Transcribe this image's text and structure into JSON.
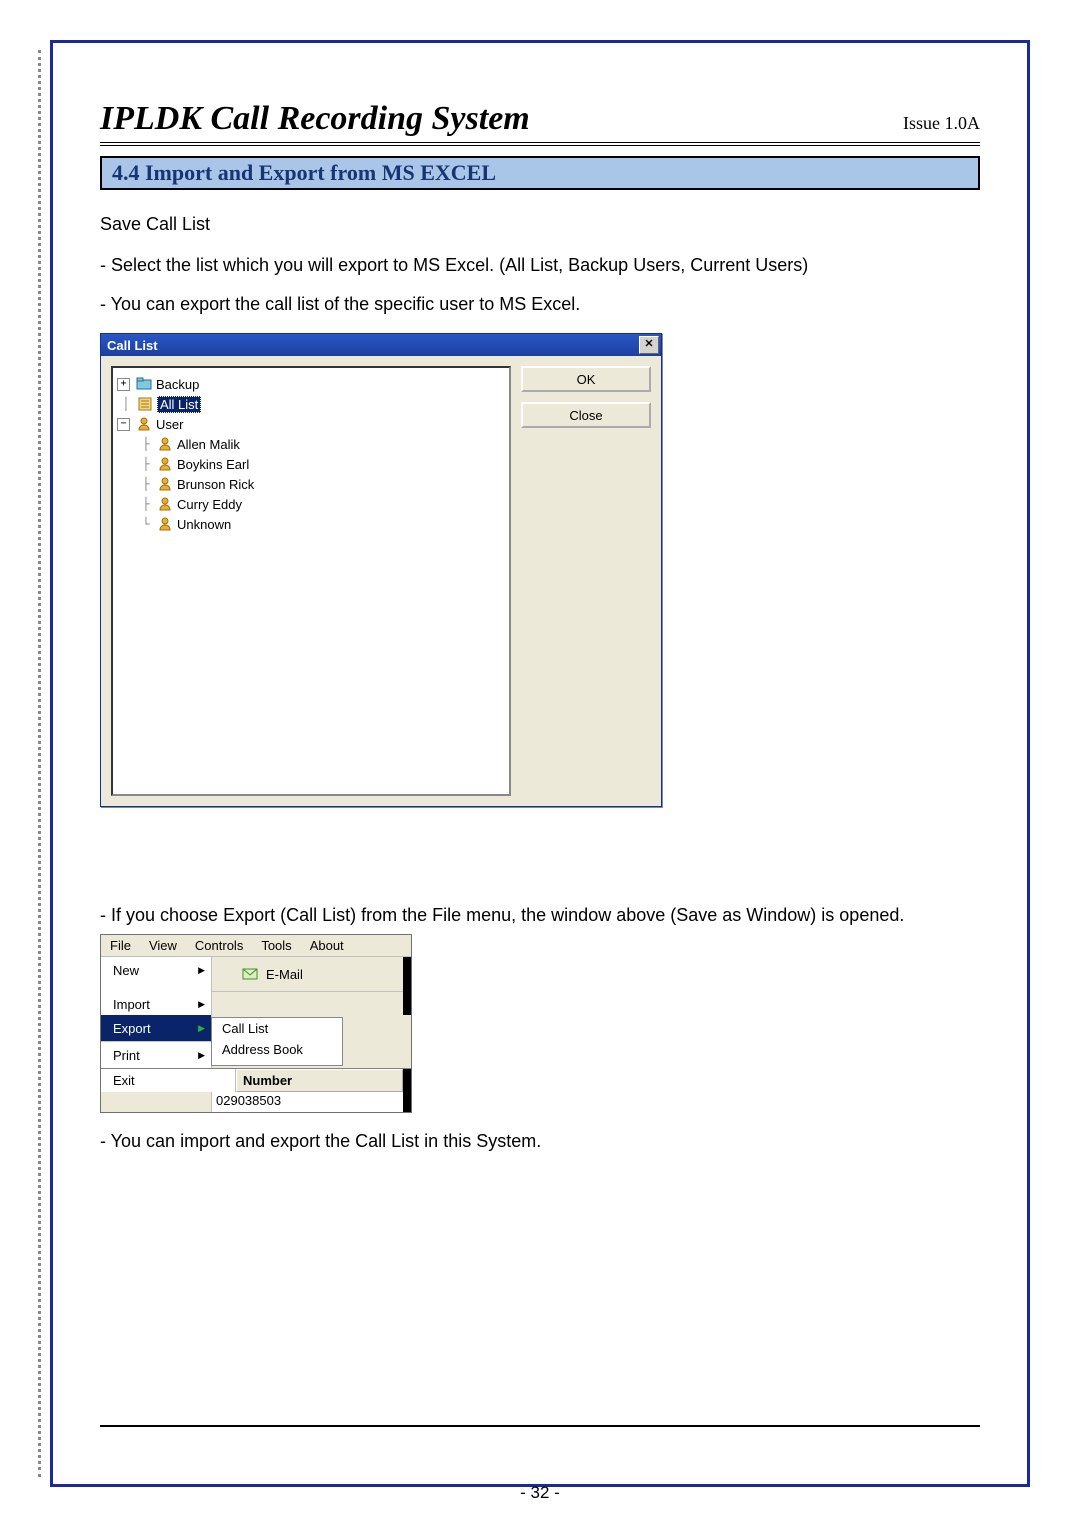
{
  "header": {
    "title": "IPLDK Call Recording System",
    "issue": "Issue 1.0A"
  },
  "section": {
    "number_title": "4.4 Import and Export from MS EXCEL"
  },
  "body": {
    "save_heading": "Save Call List",
    "bullet1": "- Select the list which you will export to MS Excel. (All List, Backup Users, Current Users)",
    "bullet2": "- You can export the call list of the specific user to MS Excel.",
    "bullet3": "- If you choose Export (Call List) from the File menu, the window above (Save as Window) is opened.",
    "bullet4": "- You can import and export the Call List in this System."
  },
  "dialog": {
    "title": "Call List",
    "buttons": {
      "ok": "OK",
      "close": "Close"
    },
    "tree": {
      "backup": "Backup",
      "all_list": "All List",
      "user": "User",
      "users": [
        "Allen Malik",
        "Boykins Earl",
        "Brunson Rick",
        "Curry Eddy",
        "Unknown"
      ]
    }
  },
  "menu": {
    "menubar": [
      "File",
      "View",
      "Controls",
      "Tools",
      "About"
    ],
    "file_items": {
      "new": "New",
      "import": "Import",
      "export": "Export",
      "print": "Print",
      "exit": "Exit"
    },
    "export_sub": {
      "call_list": "Call List",
      "address_book": "Address Book"
    },
    "email_label": "E-Mail",
    "number_header": "Number",
    "number_value": "029038503"
  },
  "page_number": "- 32 -"
}
